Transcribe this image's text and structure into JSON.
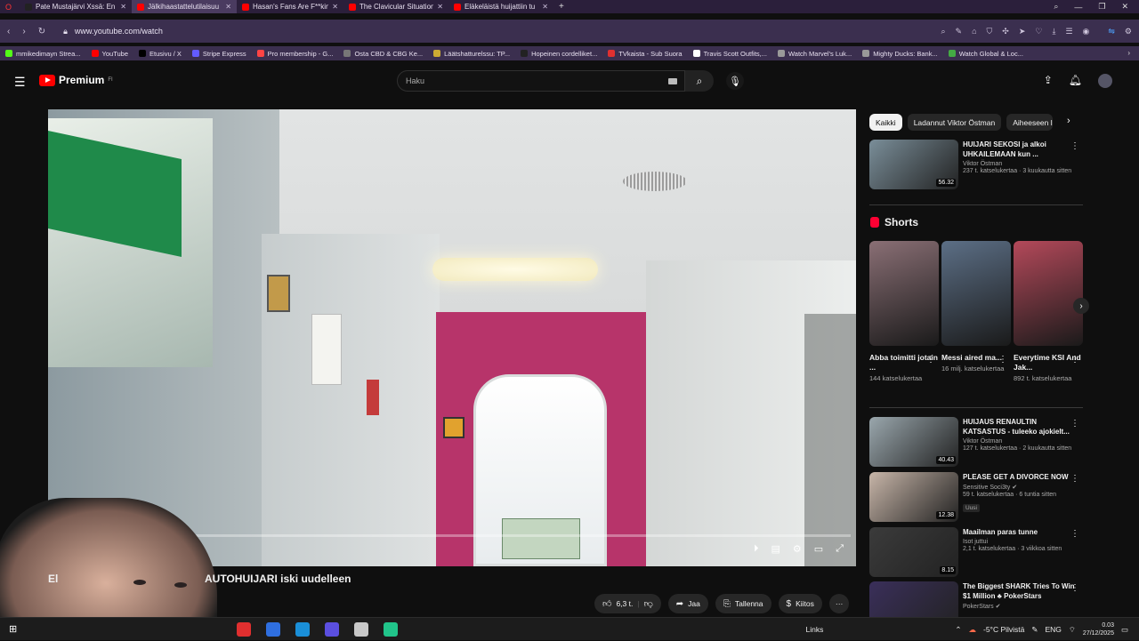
{
  "browser": {
    "tabs": [
      {
        "label": "Pate Mustajärvi Xssä: En",
        "color": "#222222",
        "active": false
      },
      {
        "label": "Jälkihaastattelutilaisuu",
        "color": "#ff0000",
        "active": true
      },
      {
        "label": "Hasan's Fans Are F**king",
        "color": "#ff0000",
        "active": false
      },
      {
        "label": "The Clavicular Situation Ju",
        "color": "#ff0000",
        "active": false
      },
      {
        "label": "Eläkeläistä huijattiin tu",
        "color": "#ff0000",
        "active": false
      }
    ],
    "new_tab": "+",
    "url": "www.youtube.com/watch",
    "bookmarks": [
      {
        "label": "mmikedimayn Strea...",
        "color": "#53fc18"
      },
      {
        "label": "YouTube",
        "color": "#ff0000"
      },
      {
        "label": "Etusivu / X",
        "color": "#000000"
      },
      {
        "label": "Stripe Express",
        "color": "#635bff"
      },
      {
        "label": "Pro membership - G...",
        "color": "#ff4444"
      },
      {
        "label": "Osta CBD & CBG Ke...",
        "color": "#777777"
      },
      {
        "label": "Läätshatturelssu: TP...",
        "color": "#ccaa33"
      },
      {
        "label": "Hopeinen cordelliket...",
        "color": "#222222"
      },
      {
        "label": "TVkaista - Sub Suora",
        "color": "#e03030"
      },
      {
        "label": "Travis Scott Outfits,...",
        "color": "#ffffff"
      },
      {
        "label": "Watch Marvel's Luk...",
        "color": "#999999"
      },
      {
        "label": "Mighty Ducks: Bank...",
        "color": "#999999"
      },
      {
        "label": "Watch Global & Loc...",
        "color": "#44aa44"
      }
    ]
  },
  "youtube": {
    "logo_text": "Premium",
    "logo_sup": "FI",
    "search_placeholder": "Haku"
  },
  "video": {
    "progress": 0.01,
    "title_prefix": "El",
    "title": "AUTOHUIJARI iski uudelleen"
  },
  "actions": {
    "like_count": "6,3 t.",
    "share_label": "Jaa",
    "save_label": "Tallenna",
    "thanks_label": "Kiitos",
    "more": "···"
  },
  "chips": [
    "Kaikki",
    "Ladannut Viktor Östman",
    "Aiheeseen li"
  ],
  "sidebar": {
    "cards_top": [
      {
        "title": "HUIJARI SEKOSI ja alkoi UHKAILEMAAN kun ...",
        "channel": "Viktor Östman",
        "meta": "237 t. katselukertaa · 3 kuukautta sitten",
        "duration": "56.32",
        "thumb": "#7a8e99"
      }
    ],
    "shorts_label": "Shorts",
    "shorts": [
      {
        "title": "Abba toimitti jotain ...",
        "views": "144 katselukertaa",
        "thumb": "#8a6f75"
      },
      {
        "title": "Messi aired ma...",
        "views": "16 milj. katselukertaa",
        "thumb": "#5c6f86"
      },
      {
        "title": "Everytime KSI And Jak...",
        "views": "892 t. katselukertaa",
        "thumb": "#b4495a"
      }
    ],
    "cards_bottom": [
      {
        "title": "HUIJAUS RENAULTIN KATSASTUS - tuleeko ajokielt...",
        "channel": "Viktor Östman",
        "meta": "127 t. katselukertaa · 2 kuukautta sitten",
        "duration": "40.43",
        "badge": "",
        "thumb": "#9aa7ad"
      },
      {
        "title": "PLEASE GET A DIVORCE NOW",
        "channel": "Sensitive Soci3ty ✔",
        "meta": "59 t. katselukertaa · 6 tuntia sitten",
        "duration": "12.38",
        "badge": "Uusi",
        "thumb": "#c7b5a8"
      },
      {
        "title": "Maailman paras tunne",
        "channel": "Isot juttui",
        "meta": "2,1 t. katselukertaa · 3 viikkoa sitten",
        "duration": "8.15",
        "badge": "",
        "thumb": "#3b3b3b"
      },
      {
        "title": "The Biggest SHARK Tries To Win $1 Million ♣ PokerStars",
        "channel": "PokerStars ✔",
        "meta": "",
        "duration": "",
        "badge": "",
        "thumb": "#3a2f5a"
      }
    ]
  },
  "taskbar": {
    "links_label": "Links",
    "weather": "-5°C  Pilvistä",
    "lang": "ENG",
    "time": "0.03",
    "date": "27/12/2025",
    "apps": [
      "#e02f2f",
      "#2f6fe0",
      "#1a8fd8",
      "#5b4fe0",
      "#c8c8c8",
      "#21c48a"
    ]
  }
}
